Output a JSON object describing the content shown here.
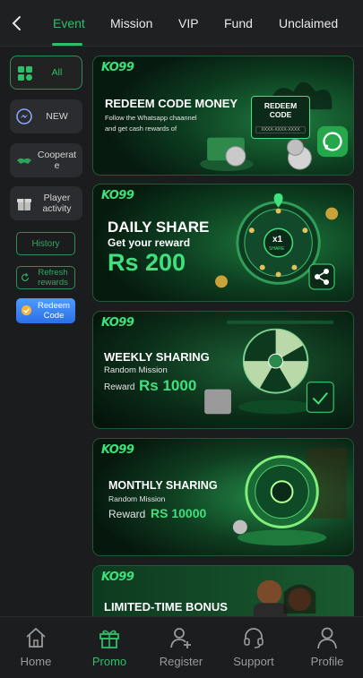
{
  "tabs": [
    "Event",
    "Mission",
    "VIP",
    "Fund",
    "Unclaimed"
  ],
  "active_tab": "Event",
  "sidebar": {
    "all": "All",
    "new": "NEW",
    "cooperate": "Cooperat e",
    "player_activity": "Player activity",
    "history": "History",
    "refresh": "Refresh rewards",
    "redeem": "Redeem Code"
  },
  "cards": {
    "redeem": {
      "logo": "KO99",
      "title": "REDEEM CODE MONEY",
      "line1": "Follow the Whatsapp chaannel",
      "line2": "and get cash rewards of",
      "box_title": "REDEEM CODE",
      "box_code": "XXXX-XXXX-XXXX"
    },
    "daily": {
      "logo": "KO99",
      "title": "DAILY SHARE",
      "sub": "Get your reward",
      "amount": "Rs 200",
      "wheel_center": "x1",
      "wheel_center_sub": "SHARE"
    },
    "weekly": {
      "logo": "KO99",
      "title": "WEEKLY SHARING",
      "sub": "Random Mission",
      "reward_label": "Reward",
      "amount": "Rs 1000"
    },
    "monthly": {
      "logo": "KO99",
      "title": "MONTHLY SHARING",
      "sub": "Random Mission",
      "reward_label": "Reward",
      "amount": "RS 10000"
    },
    "limited": {
      "logo": "KO99",
      "title": "LIMITED-TIME BONUS"
    }
  },
  "bottom_nav": [
    "Home",
    "Promo",
    "Register",
    "Support",
    "Profile"
  ],
  "active_nav": "Promo",
  "colors": {
    "accent": "#2fbf6a",
    "background": "#1b1c1e",
    "card_border": "#1f5a36"
  },
  "icons": [
    "back-arrow-icon",
    "grid-icon",
    "messenger-icon",
    "handshake-icon",
    "gift-icon",
    "refresh-icon",
    "redeem-icon",
    "home-icon",
    "gift-icon",
    "add-user-icon",
    "headset-icon",
    "user-icon",
    "whatsapp-icon",
    "share-icon"
  ]
}
